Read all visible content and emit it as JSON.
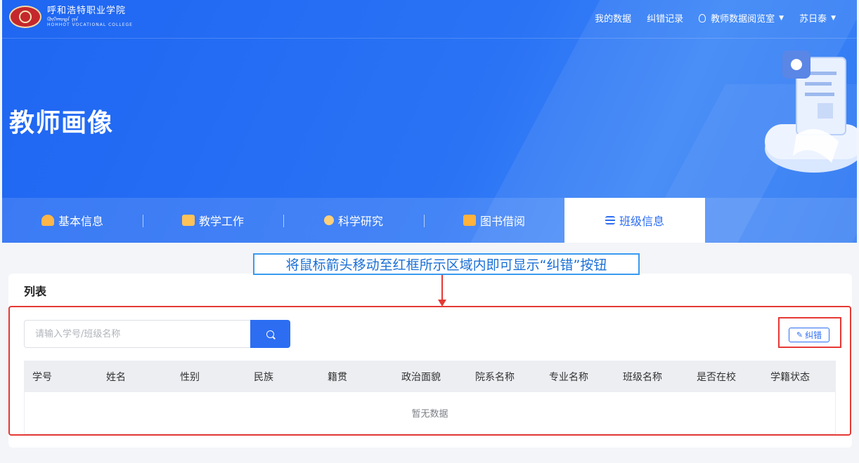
{
  "brand": {
    "name_cn": "呼和浩特职业学院",
    "name_mn": "ᠬᠥᠬᠡᠬᠣᠲᠠ ᠶᠢᠨ",
    "name_en": "HOHHOT VOCATIONAL COLLEGE"
  },
  "nav": [
    {
      "label": "我的数据",
      "icon": "",
      "dropdown": false
    },
    {
      "label": "纠错记录",
      "icon": "",
      "dropdown": false
    },
    {
      "label": "教师数据阅览室",
      "icon": "lightbulb-icon",
      "dropdown": true
    },
    {
      "label": "苏日泰",
      "icon": "",
      "dropdown": true
    }
  ],
  "page_title": "教师画像",
  "tabs": [
    {
      "label": "基本信息",
      "icon": "graduation-cap-icon",
      "active": false
    },
    {
      "label": "教学工作",
      "icon": "book-icon",
      "active": false
    },
    {
      "label": "科学研究",
      "icon": "people-icon",
      "active": false
    },
    {
      "label": "图书借阅",
      "icon": "library-icon",
      "active": false
    },
    {
      "label": "班级信息",
      "icon": "menu-icon",
      "active": true
    }
  ],
  "annotation": {
    "text": "将鼠标箭头移动至红框所示区域内即可显示“纠错”按钮"
  },
  "list": {
    "title": "列表",
    "search_placeholder": "请输入学号/班级名称",
    "search_value": "",
    "correct_button": "纠错",
    "columns": [
      "学号",
      "姓名",
      "性别",
      "民族",
      "籍贯",
      "政治面貌",
      "院系名称",
      "专业名称",
      "班级名称",
      "是否在校",
      "学籍状态"
    ],
    "rows": [],
    "empty_text": "暂无数据"
  },
  "colors": {
    "primary": "#2c6df2",
    "highlight": "#e53935",
    "callout_border": "#3a9af0"
  }
}
